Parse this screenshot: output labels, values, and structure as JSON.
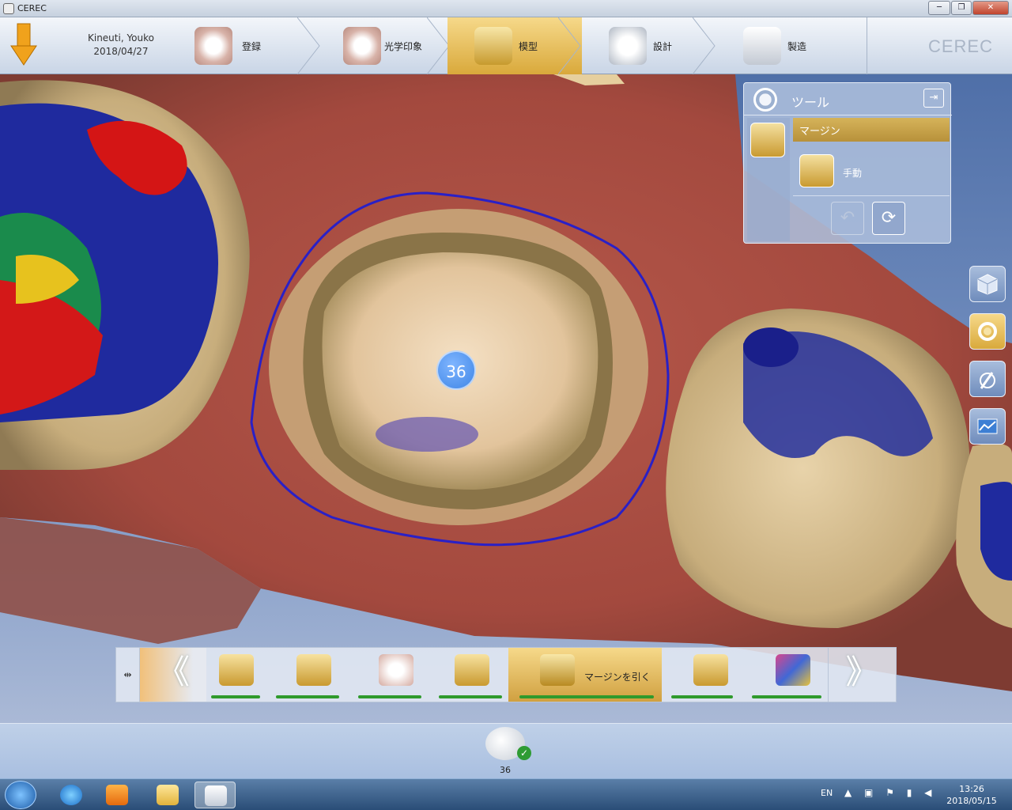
{
  "window": {
    "title": "CEREC",
    "buttons": [
      "─",
      "❐",
      "✕"
    ]
  },
  "patient": {
    "name": "Kineuti, Youko",
    "date": "2018/04/27"
  },
  "workflow": [
    {
      "label": "登録",
      "icon": "admin-jaw-icon",
      "active": false
    },
    {
      "label": "光学印象",
      "icon": "scan-jaw-icon",
      "active": false
    },
    {
      "label": "模型",
      "icon": "model-icon",
      "active": true
    },
    {
      "label": "設計",
      "icon": "design-crown-icon",
      "active": false
    },
    {
      "label": "製造",
      "icon": "milling-unit-icon",
      "active": false
    }
  ],
  "brand": "CEREC",
  "viewport": {
    "tooth_number": "36"
  },
  "tools": {
    "title": "ツール",
    "collapse_icon": "⇥",
    "section": "マージン",
    "option": "手動",
    "undo_icon": "↶",
    "reset_icon": "⟳"
  },
  "side_buttons": [
    {
      "icon": "cube-view-icon",
      "active": false
    },
    {
      "icon": "tools-ring-icon",
      "active": true
    },
    {
      "icon": "pen-tool-icon",
      "active": false
    },
    {
      "icon": "analysis-icon",
      "active": false
    }
  ],
  "strip": {
    "pin_icon": "⇹",
    "prev_icon": "《",
    "next_icon": "》",
    "steps": [
      {
        "icon": "cut-segment-icon"
      },
      {
        "icon": "trim-model-icon"
      },
      {
        "icon": "bite-registration-icon"
      },
      {
        "icon": "model-axis-icon"
      },
      {
        "icon": "margin-draw-icon",
        "label": "マージンを引く",
        "active": true
      },
      {
        "icon": "insertion-axis-icon"
      },
      {
        "icon": "inspect-model-icon"
      }
    ]
  },
  "restoration": {
    "tooth": "36",
    "status_icon": "✓"
  },
  "taskbar": {
    "language": "EN",
    "tray": "▲ ▣ ⚑ ▮ ◀",
    "time": "13:26",
    "date": "2018/05/15"
  }
}
